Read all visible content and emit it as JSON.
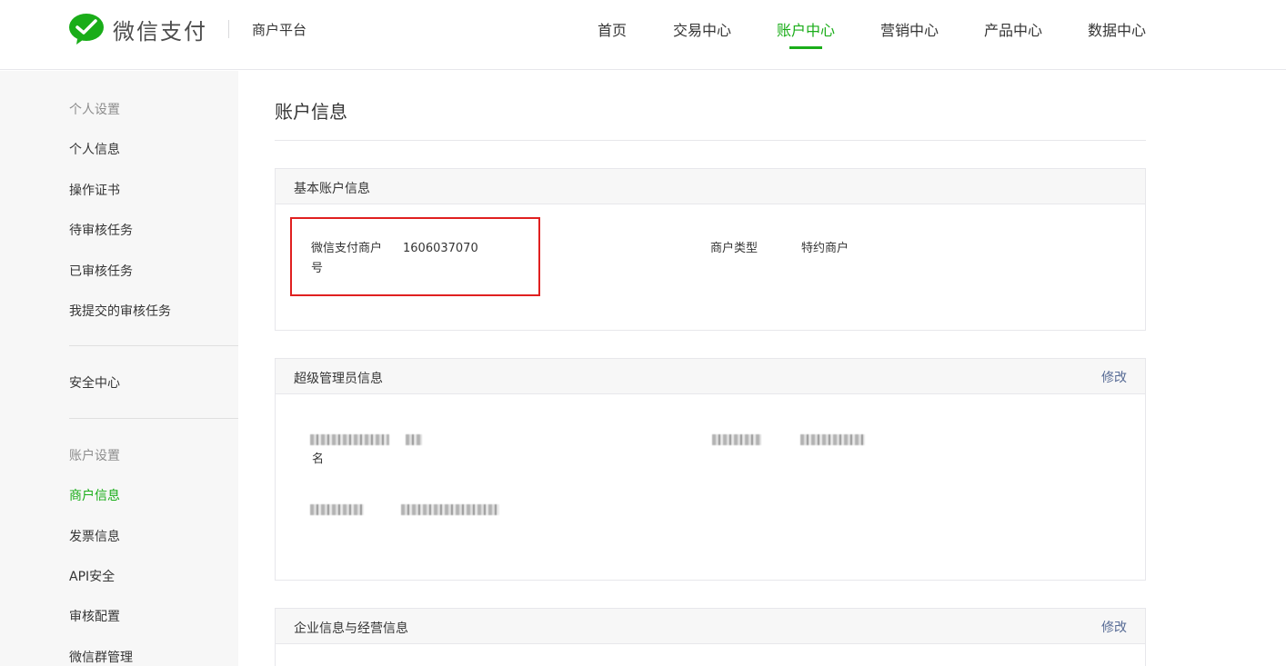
{
  "header": {
    "brand": "微信支付",
    "platform": "商户平台",
    "nav": [
      {
        "label": "首页",
        "active": false
      },
      {
        "label": "交易中心",
        "active": false
      },
      {
        "label": "账户中心",
        "active": true
      },
      {
        "label": "营销中心",
        "active": false
      },
      {
        "label": "产品中心",
        "active": false
      },
      {
        "label": "数据中心",
        "active": false
      }
    ]
  },
  "sidebar": {
    "group1_title": "个人设置",
    "group1_items": [
      "个人信息",
      "操作证书",
      "待审核任务",
      "已审核任务",
      "我提交的审核任务"
    ],
    "security": "安全中心",
    "group2_title": "账户设置",
    "group2_items": [
      "商户信息",
      "发票信息",
      "API安全",
      "审核配置",
      "微信群管理"
    ],
    "active_item": "商户信息"
  },
  "main": {
    "page_title": "账户信息",
    "basic": {
      "title": "基本账户信息",
      "merchant_id_label_line1": "微信支付商户",
      "merchant_id_label_line2": "号",
      "merchant_id_value": "1606037070",
      "merchant_type_label": "商户类型",
      "merchant_type_value": "特约商户"
    },
    "admin": {
      "title": "超级管理员信息",
      "edit_label": "修改",
      "name_label_suffix": "名"
    },
    "enterprise": {
      "title": "企业信息与经营信息",
      "edit_label": "修改"
    }
  },
  "colors": {
    "brand_green": "#1aad19",
    "link_blue": "#576b95",
    "highlight_red": "#e02020"
  }
}
